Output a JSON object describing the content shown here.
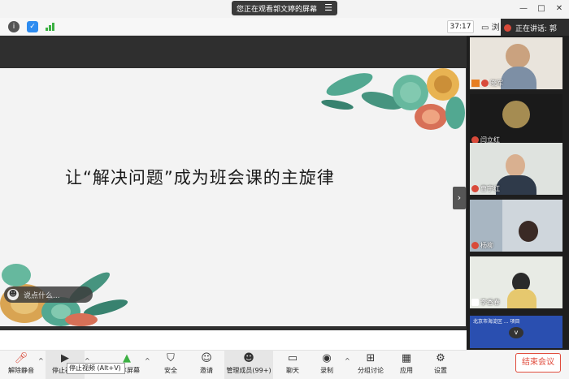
{
  "window": {
    "share_banner": "您正在观看郭文婷的屏幕",
    "menu_glyph": "☰",
    "minimize": "—",
    "maximize": "□",
    "close": "✕"
  },
  "top": {
    "timer": "37:17",
    "view_label": "▭ 浏",
    "speaking_label": "正在讲话: 郭"
  },
  "slide": {
    "title": "让“解决问题”成为班会课的主旋律"
  },
  "chat": {
    "placeholder": "说点什么..."
  },
  "participants": [
    {
      "name": "晓军",
      "muted": true,
      "badge": true
    },
    {
      "name": "闫立红",
      "muted": true
    },
    {
      "name": "曹宇红",
      "muted": true
    },
    {
      "name": "杨柳",
      "muted": true
    },
    {
      "name": "李香春",
      "muted": false
    },
    {
      "name": "北京市海淀区",
      "banner": "北京市海淀区 ... 项目"
    }
  ],
  "bottom": {
    "unmute": "解除静音",
    "stop_video": "停止视频",
    "share": "共享屏幕",
    "security": "安全",
    "invite": "邀请",
    "members": "管理成员(99+)",
    "chat": "聊天",
    "record": "录制",
    "breakout": "分组讨论",
    "apps": "应用",
    "settings": "设置",
    "end": "结束会议",
    "tooltip": "停止视频 (Alt+V)"
  },
  "colors": {
    "end": "#e04b3c",
    "muted": "#d94a3a",
    "accent": "#2d8cf0"
  }
}
